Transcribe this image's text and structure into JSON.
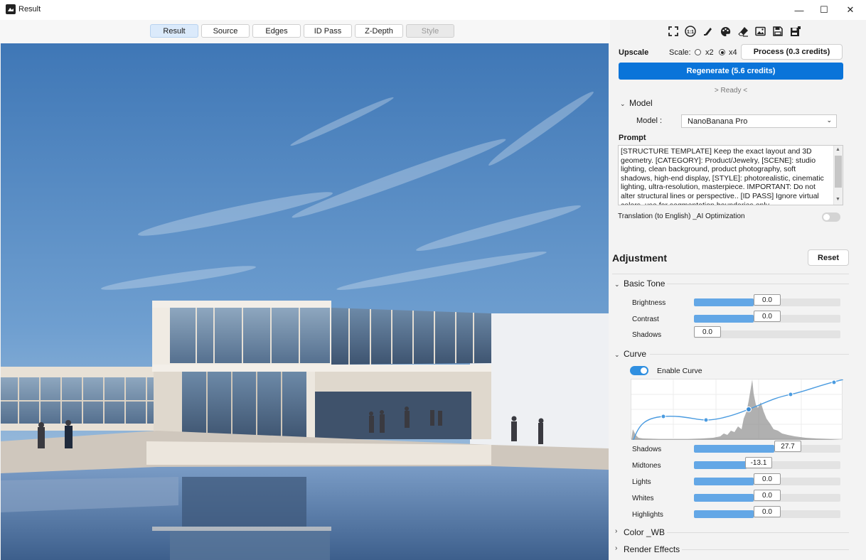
{
  "window": {
    "title": "Result",
    "minimize": "—",
    "maximize": "☐",
    "close": "✕"
  },
  "tabs": [
    {
      "label": "Result",
      "state": "active"
    },
    {
      "label": "Source",
      "state": "normal"
    },
    {
      "label": "Edges",
      "state": "normal"
    },
    {
      "label": "ID Pass",
      "state": "normal"
    },
    {
      "label": "Z-Depth",
      "state": "normal"
    },
    {
      "label": "Style",
      "state": "disabled"
    }
  ],
  "toolbar_icons": [
    "fullscreen-icon",
    "actual-size-icon",
    "brush-icon",
    "palette-icon",
    "eraser-icon",
    "image-icon",
    "save-icon",
    "save-as-icon"
  ],
  "upscale": {
    "title": "Upscale",
    "scale_label": "Scale:",
    "options": [
      {
        "label": "x2",
        "selected": false
      },
      {
        "label": "x4",
        "selected": true
      }
    ],
    "process_label": "Process (0.3 credits)"
  },
  "regenerate_label": "Regenerate (5.6 credits)",
  "status": "> Ready <",
  "model_section": {
    "title": "Model",
    "label": "Model :",
    "value": "NanoBanana Pro"
  },
  "prompt": {
    "title": "Prompt",
    "text": "[STRUCTURE TEMPLATE] Keep the exact layout and 3D geometry. [CATEGORY]: Product/Jewelry, [SCENE]: studio lighting, clean background, product photography, soft shadows, high-end display, [STYLE]: photorealistic, cinematic lighting, ultra-resolution, masterpiece. IMPORTANT: Do not alter structural lines or perspective.. [ID PASS] Ignore virtual colors, use for segmentation boundaries only."
  },
  "translation": {
    "label": "Translation (to English) _AI Optimization",
    "enabled": false
  },
  "adjustment": {
    "title": "Adjustment",
    "reset_label": "Reset"
  },
  "basic_tone": {
    "title": "Basic Tone",
    "sliders": [
      {
        "label": "Brightness",
        "value": "0.0",
        "fill": 0.41
      },
      {
        "label": "Contrast",
        "value": "0.0",
        "fill": 0.41
      },
      {
        "label": "Shadows",
        "value": "0.0",
        "fill": 0.0
      }
    ]
  },
  "curve": {
    "title": "Curve",
    "enable_label": "Enable Curve",
    "enabled": true,
    "sliders": [
      {
        "label": "Shadows",
        "value": "27.7",
        "fill": 0.55
      },
      {
        "label": "Midtones",
        "value": "-13.1",
        "fill": 0.36
      },
      {
        "label": "Lights",
        "value": "0.0",
        "fill": 0.41
      },
      {
        "label": "Whites",
        "value": "0.0",
        "fill": 0.41
      },
      {
        "label": "Highlights",
        "value": "0.0",
        "fill": 0.41
      }
    ]
  },
  "collapsed_sections": [
    {
      "title": "Color _WB"
    },
    {
      "title": "Render Effects"
    }
  ],
  "colors": {
    "accent": "#0a74d9",
    "slider_fill": "#63a7e6",
    "toggle_on": "#2f8fe0"
  }
}
